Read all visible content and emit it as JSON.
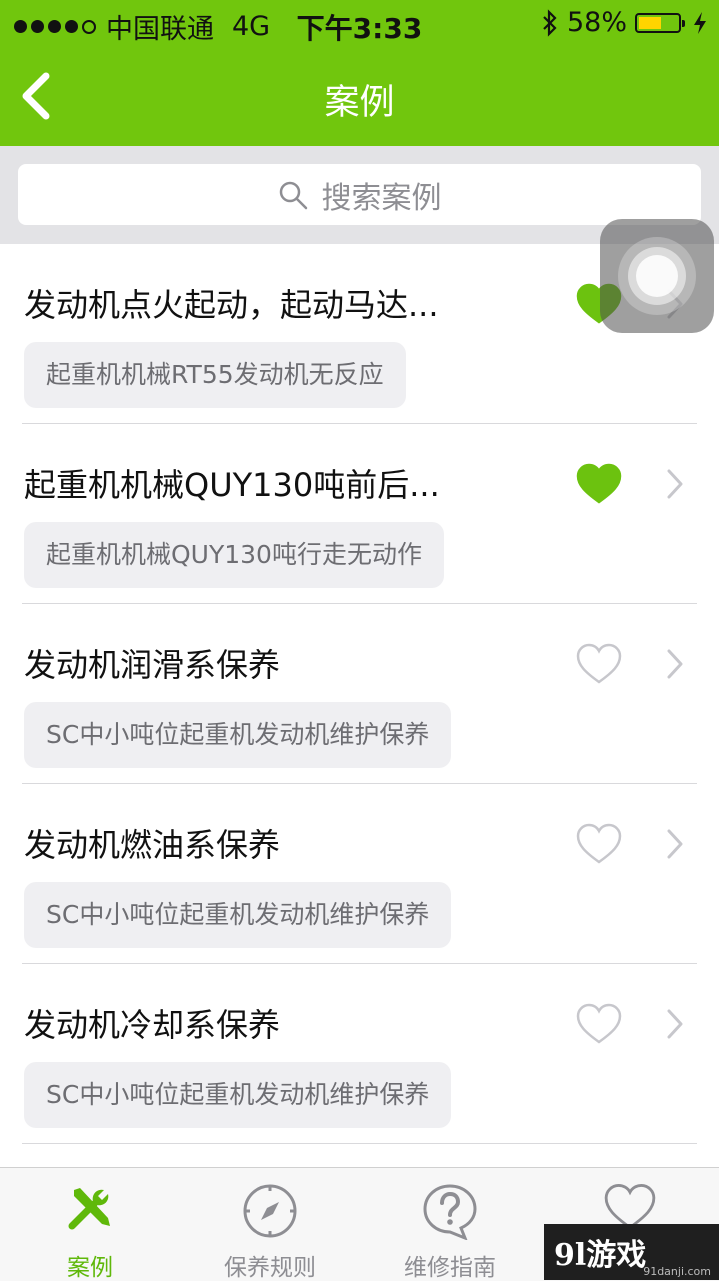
{
  "status_bar": {
    "carrier": "中国联通",
    "network": "4G",
    "time": "下午3:33",
    "battery": "58%",
    "battery_level": 0.58
  },
  "nav": {
    "title": "案例",
    "back_icon": "chevron-left-icon"
  },
  "search": {
    "placeholder": "搜索案例",
    "icon": "search-icon"
  },
  "cases": [
    {
      "title": "发动机点火起动，起动马达...",
      "tag": "起重机机械RT55发动机无反应",
      "favorited": true
    },
    {
      "title": "起重机机械QUY130吨前后...",
      "tag": "起重机机械QUY130吨行走无动作",
      "favorited": true
    },
    {
      "title": "发动机润滑系保养",
      "tag": "SC中小吨位起重机发动机维护保养",
      "favorited": false
    },
    {
      "title": "发动机燃油系保养",
      "tag": "SC中小吨位起重机发动机维护保养",
      "favorited": false
    },
    {
      "title": "发动机冷却系保养",
      "tag": "SC中小吨位起重机发动机维护保养",
      "favorited": false
    }
  ],
  "tabbar": {
    "tabs": [
      {
        "label": "案例",
        "icon": "tools-icon",
        "active": true
      },
      {
        "label": "保养规则",
        "icon": "compass-icon",
        "active": false
      },
      {
        "label": "维修指南",
        "icon": "question-bubble-icon",
        "active": false
      },
      {
        "label": "",
        "icon": "heart-icon",
        "active": false
      }
    ]
  },
  "watermark": {
    "logo": "9l游戏",
    "site": "91danji.com"
  },
  "colors": {
    "accent": "#71c60d",
    "heart_filled": "#6cc20f",
    "heart_outline": "#c7c7cc"
  }
}
